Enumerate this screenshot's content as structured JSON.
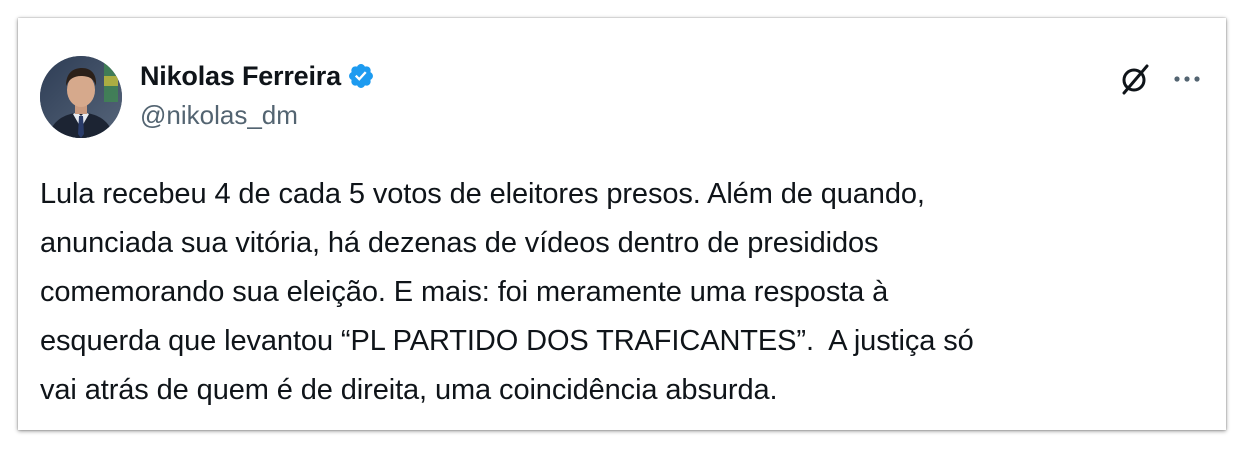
{
  "tweet": {
    "author": {
      "display_name": "Nikolas Ferreira",
      "handle": "@nikolas_dm",
      "verified": true,
      "avatar_icon": "profile-photo-icon"
    },
    "text_lines": [
      "Lula recebeu 4 de cada 5 votos de eleitores presos. Além de quando,",
      "anunciada sua vitória, há dezenas de vídeos dentro de presididos",
      "comemorando sua eleição. E mais: foi meramente uma resposta à",
      "esquerda que levantou “PL PARTIDO DOS TRAFICANTES”.  A justiça só",
      "vai atrás de quem é de direita, uma coincidência absurda."
    ],
    "actions": {
      "grok_icon": "grok-slash-icon",
      "more_icon": "more-options-icon"
    }
  },
  "colors": {
    "text_primary": "#0f1419",
    "text_secondary": "#536471",
    "verified_blue": "#1d9bf0"
  }
}
